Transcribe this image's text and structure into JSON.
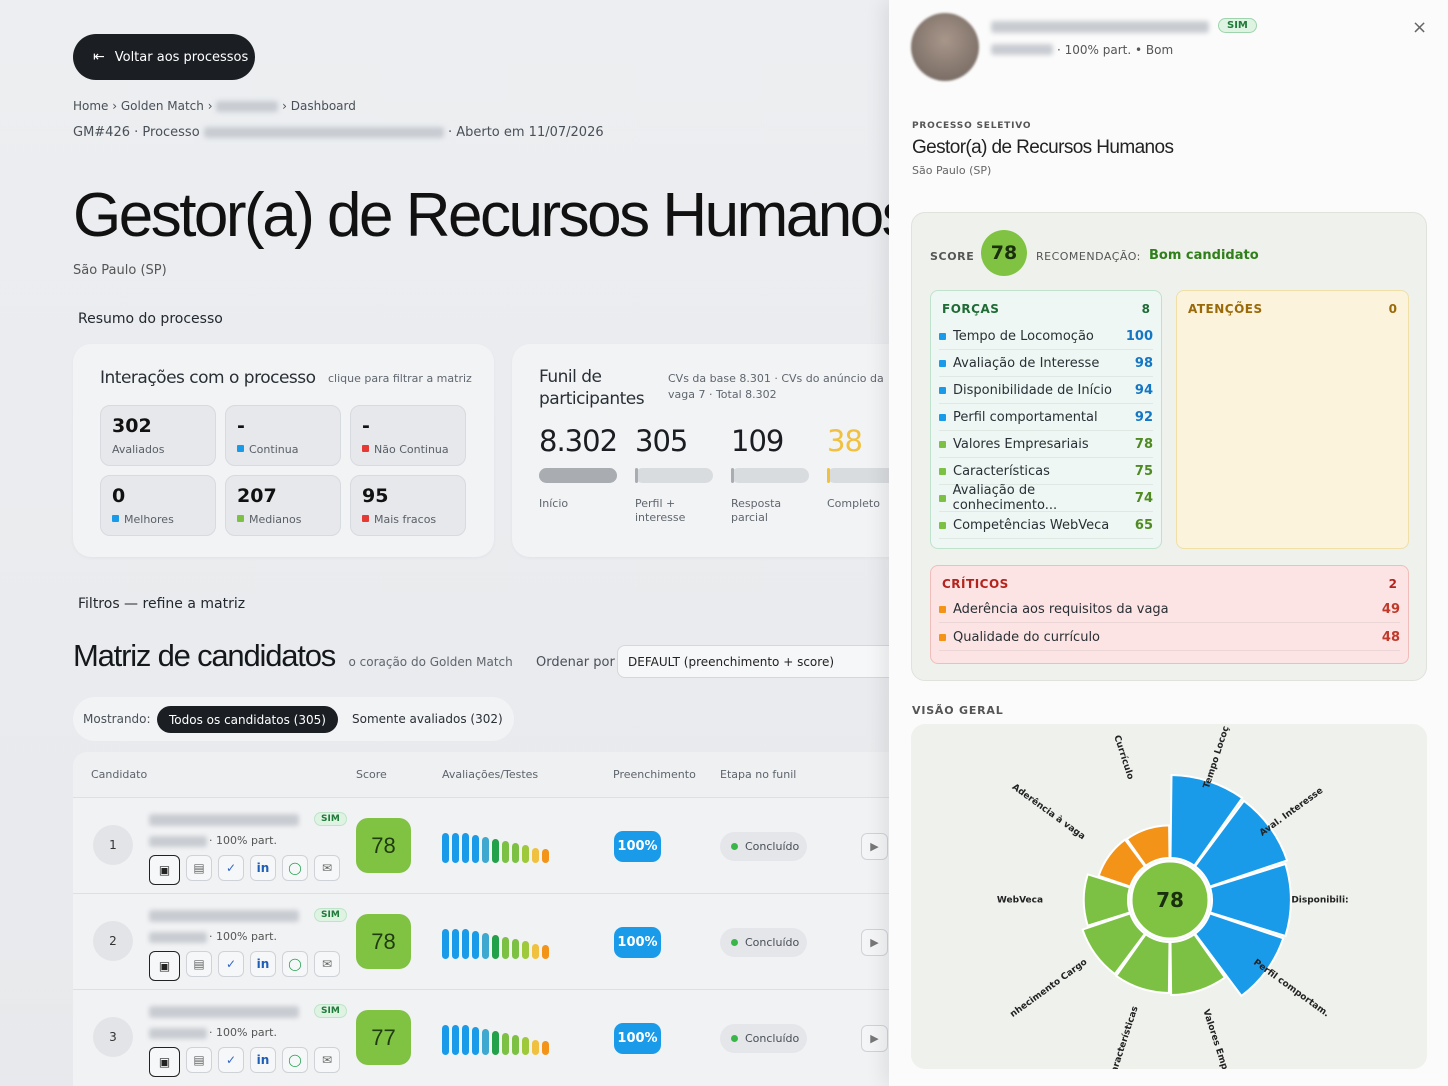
{
  "back_button": {
    "label": "Voltar aos processos"
  },
  "breadcrumb": {
    "home": "Home",
    "golden": "Golden Match",
    "dashboard": "Dashboard"
  },
  "process_line": {
    "code": "GM#426 · Processo",
    "opened": "· Aberto em 11/07/2026"
  },
  "job": {
    "title": "Gestor(a) de Recursos Humanos",
    "city": "São Paulo (SP)"
  },
  "summary": {
    "heading": "Resumo do processo",
    "interactions": {
      "title": "Interações com o processo",
      "hint": "clique para filtrar a matriz",
      "stats": [
        {
          "value": "302",
          "label": "Avaliados",
          "color": ""
        },
        {
          "value": "-",
          "label": "Continua",
          "color": "#1a9bea"
        },
        {
          "value": "-",
          "label": "Não Continua",
          "color": "#e53935"
        },
        {
          "value": "0",
          "label": "Melhores",
          "color": "#1a9bea"
        },
        {
          "value": "207",
          "label": "Medianos",
          "color": "#7cc144"
        },
        {
          "value": "95",
          "label": "Mais fracos",
          "color": "#e53935"
        }
      ]
    },
    "funnel": {
      "title": "Funil de participantes",
      "note": "CVs da base 8.301 · CVs do anúncio da vaga 7 · Total 8.302",
      "steps": [
        {
          "value": "8.302",
          "label": "Início",
          "fill": 1.0,
          "color": "#a9adb2"
        },
        {
          "value": "305",
          "label": "Perfil + interesse",
          "fill": 0.04,
          "color": "#a9adb2"
        },
        {
          "value": "109",
          "label": "Resposta parcial",
          "fill": 0.02,
          "color": "#a9adb2"
        },
        {
          "value": "38",
          "label": "Completo",
          "fill": 0.01,
          "color": "#f0c040"
        }
      ]
    }
  },
  "filters": {
    "heading": "Filtros — refine a matriz"
  },
  "matrix": {
    "title": "Matriz de candidatos",
    "subtitle": "o coração do Golden Match",
    "sort_label": "Ordenar por",
    "sort_value": "DEFAULT (preenchimento + score)",
    "showing_label": "Mostrando:",
    "tab_all": "Todos os candidatos (305)",
    "tab_rated": "Somente avaliados (302)",
    "columns": [
      "Candidato",
      "Score",
      "Avaliações/Testes",
      "Preenchimento",
      "Etapa no funil"
    ],
    "rows": [
      {
        "rank": "1",
        "badge": "SIM",
        "part": "· 100% part.",
        "score": "78",
        "fill": "100%",
        "stage": "Concluído"
      },
      {
        "rank": "2",
        "badge": "SIM",
        "part": "· 100% part.",
        "score": "78",
        "fill": "100%",
        "stage": "Concluído"
      },
      {
        "rank": "3",
        "badge": "SIM",
        "part": "· 100% part.",
        "score": "77",
        "fill": "100%",
        "stage": "Concluído"
      }
    ]
  },
  "panel": {
    "badge": "SIM",
    "meta": "· 100% part.  • Bom",
    "process_label": "PROCESSO SELETIVO",
    "job_title": "Gestor(a) de Recursos Humanos",
    "job_city": "São Paulo (SP)",
    "score_label": "SCORE",
    "score": "78",
    "rec_label": "RECOMENDAÇÃO:",
    "rec_value": "Bom candidato",
    "strengths": {
      "title": "FORÇAS",
      "count": "8",
      "items": [
        {
          "label": "Tempo de Locomoção",
          "value": "100",
          "color": "#1a9bea"
        },
        {
          "label": "Avaliação de Interesse",
          "value": "98",
          "color": "#1a9bea"
        },
        {
          "label": "Disponibilidade de Início",
          "value": "94",
          "color": "#1a9bea"
        },
        {
          "label": "Perfil comportamental",
          "value": "92",
          "color": "#1a9bea"
        },
        {
          "label": "Valores Empresariais",
          "value": "78",
          "color": "#7cc144"
        },
        {
          "label": "Características",
          "value": "75",
          "color": "#7cc144"
        },
        {
          "label": "Avaliação de conhecimento...",
          "value": "74",
          "color": "#7cc144"
        },
        {
          "label": "Competências WebVeca",
          "value": "65",
          "color": "#7cc144"
        }
      ]
    },
    "attention": {
      "title": "ATENÇÕES",
      "count": "0"
    },
    "critical": {
      "title": "CRÍTICOS",
      "count": "2",
      "items": [
        {
          "label": "Aderência aos requisitos da vaga",
          "value": "49",
          "color": "#f39419"
        },
        {
          "label": "Qualidade do currículo",
          "value": "48",
          "color": "#f39419"
        }
      ]
    },
    "overview_label": "VISÃO GERAL",
    "radial": {
      "center": "78",
      "segments": [
        {
          "label": "Tempo Locoç",
          "value": 100,
          "color": "#1a9bea"
        },
        {
          "label": "Aval. Interesse",
          "value": 98,
          "color": "#1a9bea"
        },
        {
          "label": "Disponibili:",
          "value": 94,
          "color": "#1a9bea"
        },
        {
          "label": "Perfil comportam.",
          "value": 92,
          "color": "#1a9bea"
        },
        {
          "label": "Valores Empr.",
          "value": 78,
          "color": "#7cc144"
        },
        {
          "label": "Características",
          "value": 75,
          "color": "#7cc144"
        },
        {
          "label": "nhecimento Cargo",
          "value": 74,
          "color": "#7cc144"
        },
        {
          "label": "WebVeca",
          "value": 65,
          "color": "#7cc144"
        },
        {
          "label": "Aderência à vaga",
          "value": 49,
          "color": "#f39419"
        },
        {
          "label": "Currículo",
          "value": 48,
          "color": "#f39419"
        }
      ]
    }
  }
}
